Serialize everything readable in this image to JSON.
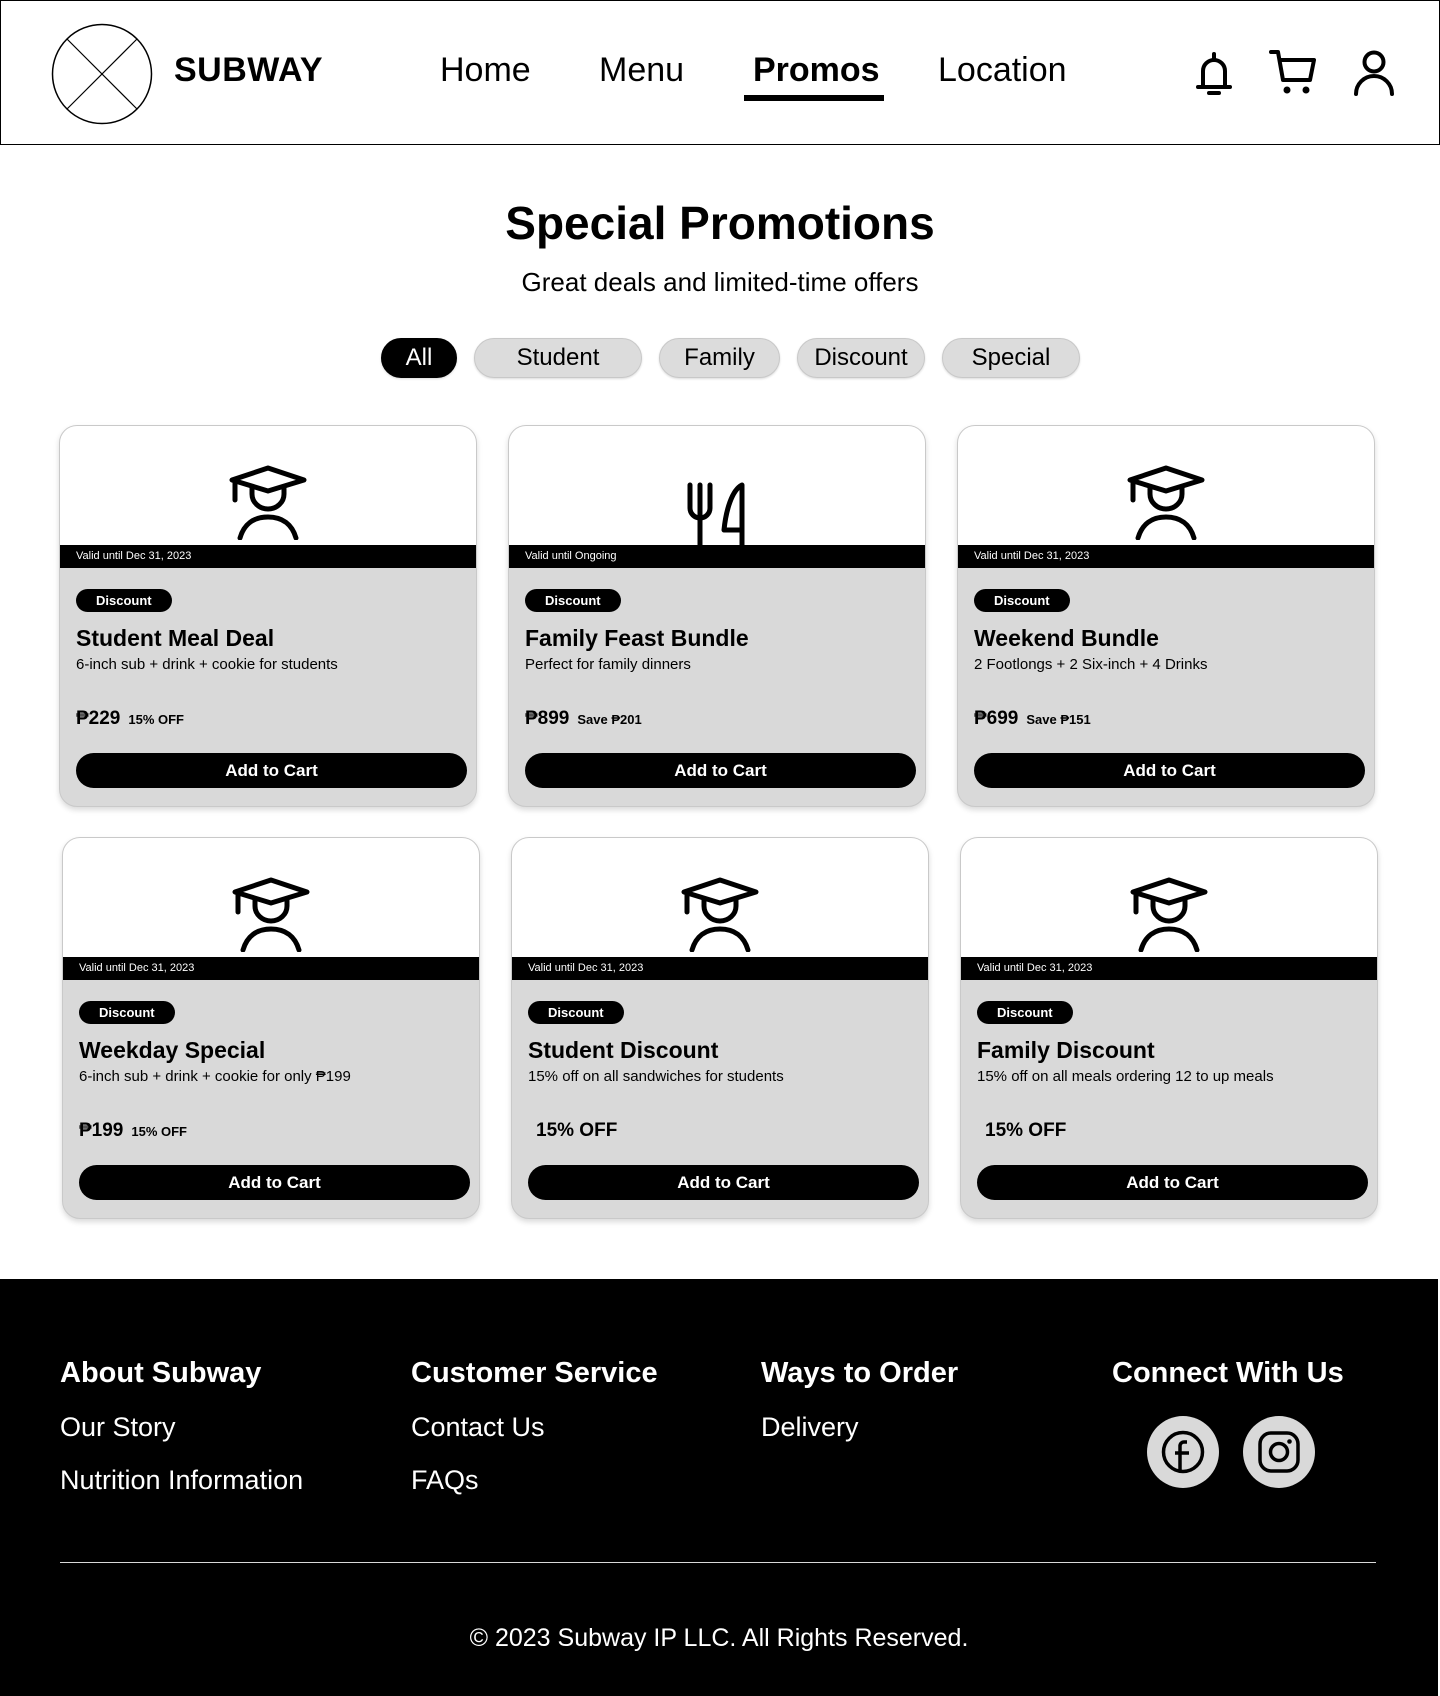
{
  "header": {
    "brand": "SUBWAY",
    "nav": [
      {
        "label": "Home",
        "active": false
      },
      {
        "label": "Menu",
        "active": false
      },
      {
        "label": "Promos",
        "active": true
      },
      {
        "label": "Location",
        "active": false
      }
    ],
    "icons": [
      "bell-icon",
      "cart-icon",
      "user-icon"
    ]
  },
  "hero": {
    "title": "Special Promotions",
    "subtitle": "Great deals and limited-time offers"
  },
  "filters": [
    {
      "label": "All",
      "active": true
    },
    {
      "label": "Student",
      "active": false
    },
    {
      "label": "Family",
      "active": false
    },
    {
      "label": "Discount",
      "active": false
    },
    {
      "label": "Special",
      "active": false
    }
  ],
  "promos": [
    {
      "icon": "graduation-cap-icon",
      "valid": "Valid until Dec 31, 2023",
      "badge": "Discount",
      "title": "Student Meal Deal",
      "desc": "6-inch sub + drink + cookie for students",
      "price": "₱229",
      "note": "15% OFF",
      "button": "Add to Cart"
    },
    {
      "icon": "fork-knife-icon",
      "valid": "Valid until Ongoing",
      "badge": "Discount",
      "title": "Family Feast Bundle",
      "desc": "Perfect for family dinners",
      "price": "₱899",
      "note": "Save ₱201",
      "button": "Add to Cart"
    },
    {
      "icon": "graduation-cap-icon",
      "valid": "Valid until Dec 31, 2023",
      "badge": "Discount",
      "title": "Weekend Bundle",
      "desc": "2 Footlongs + 2 Six-inch + 4 Drinks",
      "price": "₱699",
      "note": "Save ₱151",
      "button": "Add to Cart"
    },
    {
      "icon": "graduation-cap-icon",
      "valid": "Valid until Dec 31, 2023",
      "badge": "Discount",
      "title": "Weekday Special",
      "desc": "6-inch sub + drink + cookie for only ₱199",
      "price": "₱199",
      "note": "15% OFF",
      "button": "Add to Cart"
    },
    {
      "icon": "graduation-cap-icon",
      "valid": "Valid until Dec 31, 2023",
      "badge": "Discount",
      "title": "Student Discount",
      "desc": "15% off on all sandwiches for students",
      "price": "",
      "note": "15% OFF",
      "button": "Add to Cart"
    },
    {
      "icon": "graduation-cap-icon",
      "valid": "Valid until Dec 31, 2023",
      "badge": "Discount",
      "title": "Family Discount",
      "desc": "15% off on all meals ordering 12 to up meals",
      "price": "",
      "note": "15% OFF",
      "button": "Add to Cart"
    }
  ],
  "footer": {
    "columns": [
      {
        "heading": "About Subway",
        "links": [
          "Our Story",
          "Nutrition Information"
        ]
      },
      {
        "heading": "Customer Service",
        "links": [
          "Contact Us",
          "FAQs"
        ]
      },
      {
        "heading": "Ways to Order",
        "links": [
          "Delivery"
        ]
      },
      {
        "heading": "Connect With Us",
        "links": []
      }
    ],
    "social": [
      "facebook-icon",
      "instagram-icon"
    ],
    "copyright": "© 2023 Subway IP LLC. All Rights Reserved."
  }
}
